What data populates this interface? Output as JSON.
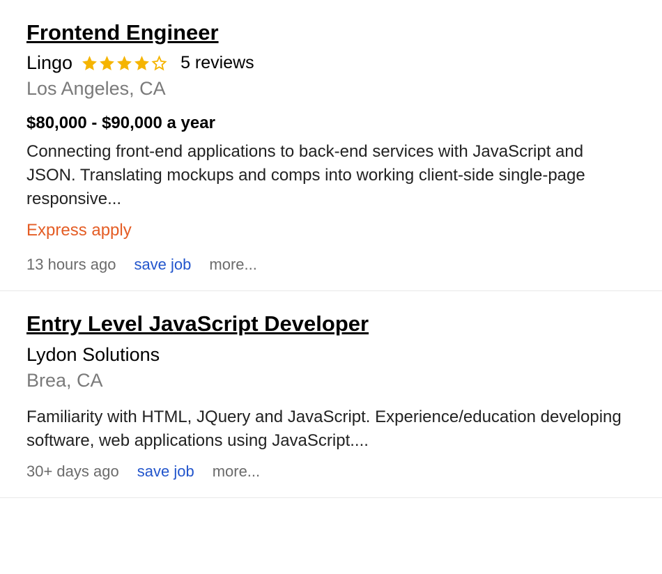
{
  "jobs": [
    {
      "title": "Frontend Engineer",
      "company": "Lingo",
      "rating": 4,
      "reviews_label": "5 reviews",
      "location": "Los Angeles, CA",
      "salary": "$80,000 - $90,000 a year",
      "description": "Connecting front-end applications to back-end services with JavaScript and JSON. Translating mockups and comps into working client-side single-page responsive...",
      "express_apply": "Express apply",
      "posted": "13 hours ago",
      "save_label": "save job",
      "more_label": "more..."
    },
    {
      "title": "Entry Level JavaScript Developer",
      "company": "Lydon Solutions",
      "location": "Brea, CA",
      "description": "Familiarity with HTML, JQuery and JavaScript. Experience/education developing software, web applications using JavaScript....",
      "posted": "30+ days ago",
      "save_label": "save job",
      "more_label": "more..."
    }
  ],
  "colors": {
    "star_fill": "#f5b400",
    "star_empty": "#f5b400",
    "express": "#e45d25",
    "link": "#2255cc"
  }
}
